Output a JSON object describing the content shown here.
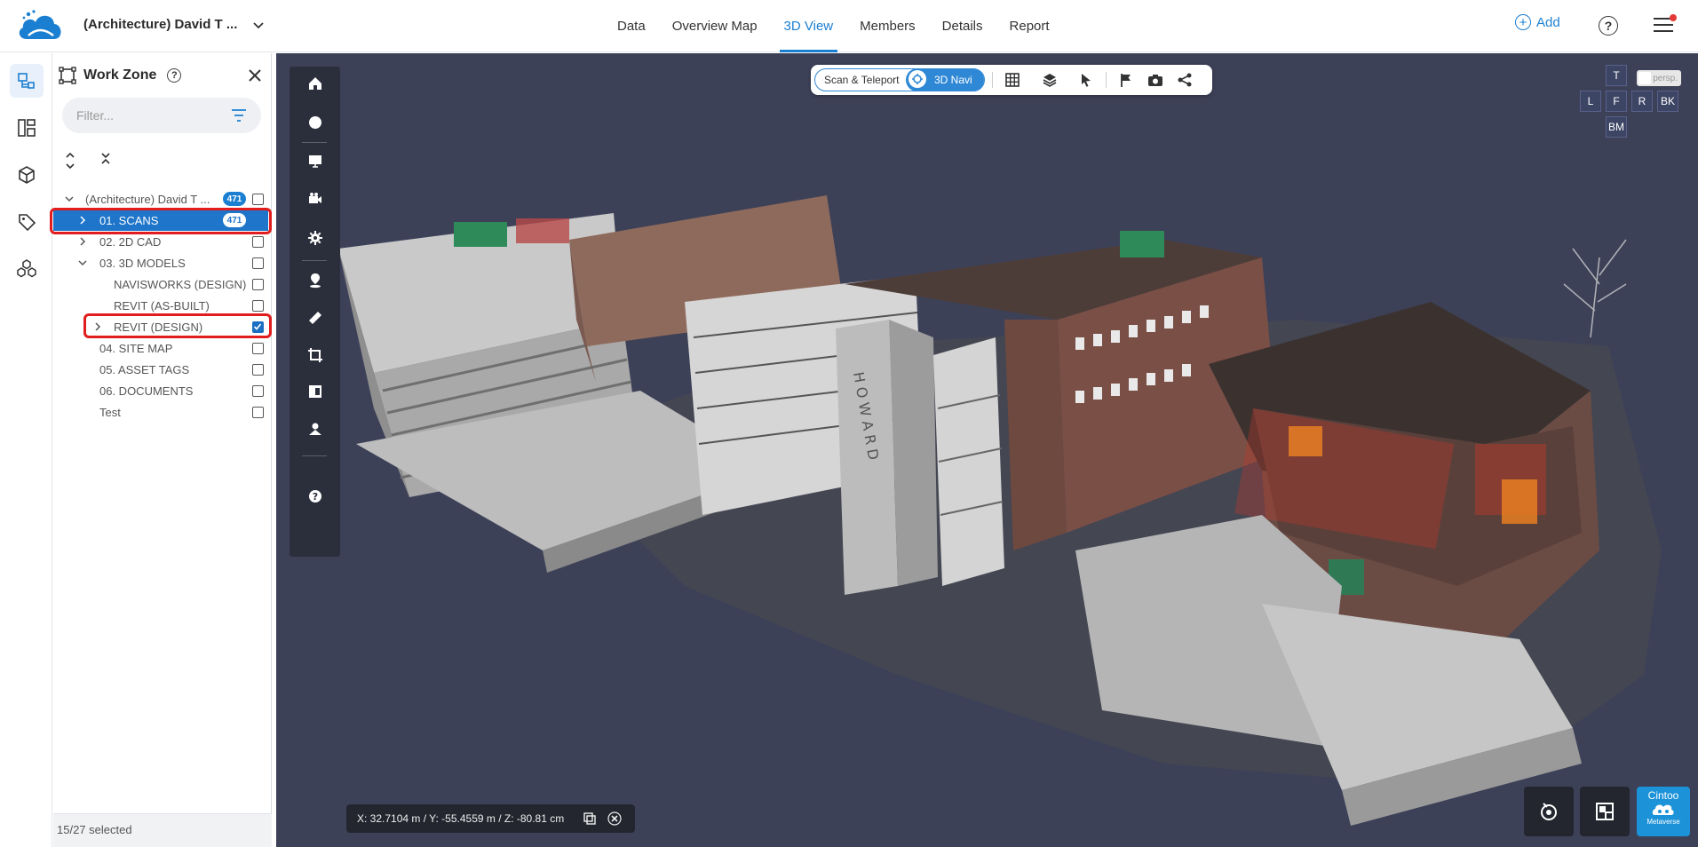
{
  "header": {
    "project_title": "(Architecture) David T ...",
    "tabs": [
      "Data",
      "Overview Map",
      "3D View",
      "Members",
      "Details",
      "Report"
    ],
    "active_tab": "3D View",
    "add_label": "Add"
  },
  "panel": {
    "title": "Work Zone",
    "filter_placeholder": "Filter...",
    "tree": [
      {
        "label": "(Architecture) David T ...",
        "badge": "471",
        "checked": false,
        "expanded": true,
        "depth": 0
      },
      {
        "label": "01. SCANS",
        "badge": "471",
        "checked": false,
        "expanded": false,
        "depth": 1,
        "selected": true
      },
      {
        "label": "02. 2D CAD",
        "checked": false,
        "expanded": false,
        "depth": 1
      },
      {
        "label": "03. 3D MODELS",
        "checked": false,
        "expanded": true,
        "depth": 1
      },
      {
        "label": "NAVISWORKS (DESIGN)",
        "checked": false,
        "depth": 2
      },
      {
        "label": "REVIT (AS-BUILT)",
        "checked": false,
        "depth": 2
      },
      {
        "label": "REVIT (DESIGN)",
        "checked": true,
        "expanded": false,
        "depth": 2
      },
      {
        "label": "04. SITE MAP",
        "checked": false,
        "depth": 1
      },
      {
        "label": "05. ASSET TAGS",
        "checked": false,
        "depth": 1
      },
      {
        "label": "06. DOCUMENTS",
        "checked": false,
        "depth": 1
      },
      {
        "label": "Test",
        "checked": false,
        "depth": 1
      }
    ],
    "footer": "15/27 selected"
  },
  "viewer": {
    "mode_left": "Scan & Teleport",
    "mode_right": "3D Navi",
    "view_cube": {
      "top": "T",
      "left": "L",
      "front": "F",
      "right": "R",
      "back": "BK",
      "bottom": "BM"
    },
    "projection": "persp.",
    "coordinates": "X: 32.7104 m / Y: -55.4559 m / Z: -80.81 cm",
    "brand": {
      "name": "Cintoo",
      "sub": "Metaverse"
    }
  },
  "colors": {
    "accent": "#1b7fd1",
    "viewport_bg": "#3d4158",
    "highlight": "#e11d1d"
  }
}
